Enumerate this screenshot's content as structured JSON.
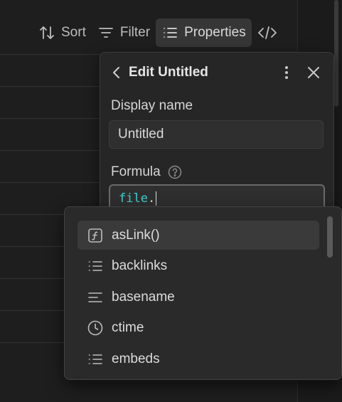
{
  "toolbar": {
    "sort_label": "Sort",
    "filter_label": "Filter",
    "properties_label": "Properties"
  },
  "panel": {
    "title": "Edit Untitled",
    "display_name_label": "Display name",
    "display_name_value": "Untitled",
    "formula_label": "Formula",
    "formula_keyword": "file",
    "formula_rest": "."
  },
  "suggestions": [
    {
      "label": "asLink()",
      "icon": "function-icon",
      "selected": true
    },
    {
      "label": "backlinks",
      "icon": "list-icon",
      "selected": false
    },
    {
      "label": "basename",
      "icon": "text-lines-icon",
      "selected": false
    },
    {
      "label": "ctime",
      "icon": "clock-icon",
      "selected": false
    },
    {
      "label": "embeds",
      "icon": "list-icon",
      "selected": false
    }
  ],
  "colors": {
    "background": "#1e1e1e",
    "panel": "#262626",
    "dropdown": "#2a2a2a",
    "keyword": "#44cfcf"
  }
}
